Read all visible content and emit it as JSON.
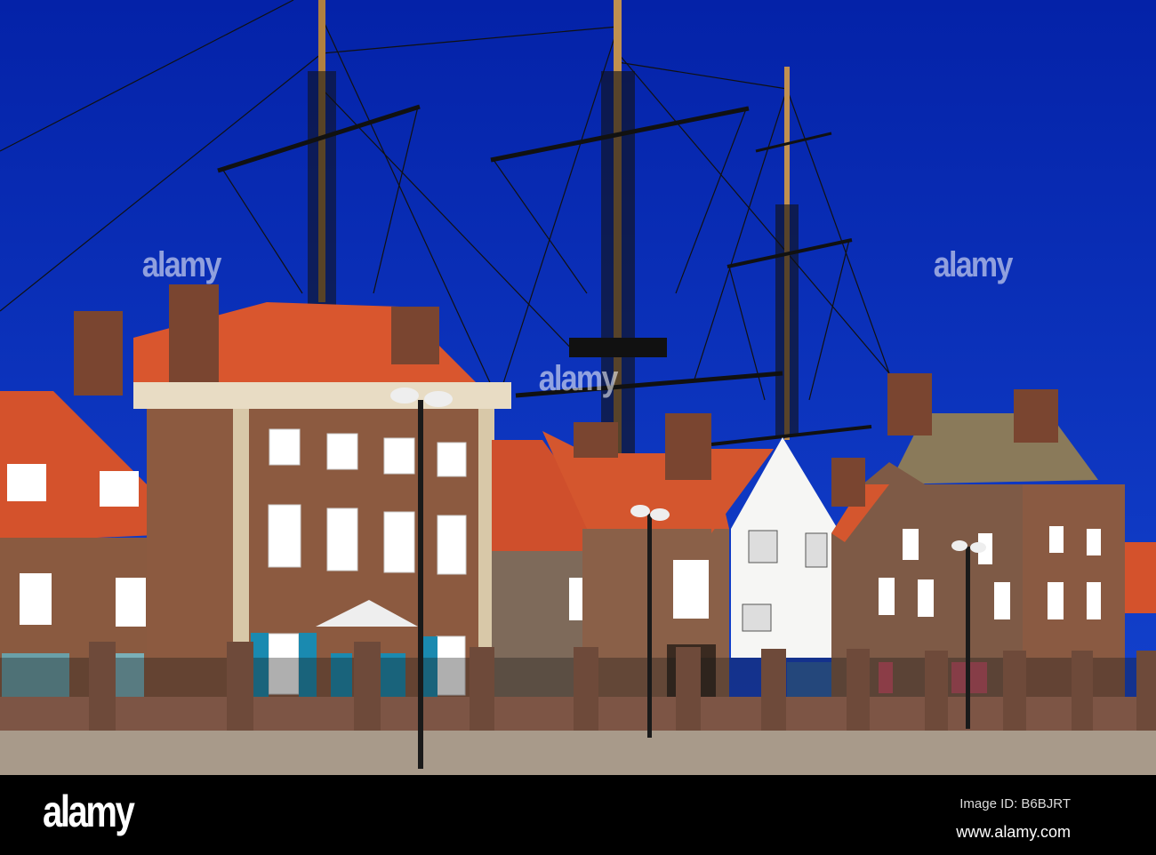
{
  "photo": {
    "subject": "Historic quay houses with tall ship masts",
    "colors": {
      "sky": "#0a2bb8",
      "roof": "#d4522c",
      "brick": "#8a5a40",
      "wall": "#7d5545",
      "pavement": "#a89a8a"
    }
  },
  "watermark": {
    "text": "alamy"
  },
  "footer": {
    "logo": "alamy",
    "image_id": "Image ID: B6BJRT",
    "website": "www.alamy.com"
  }
}
